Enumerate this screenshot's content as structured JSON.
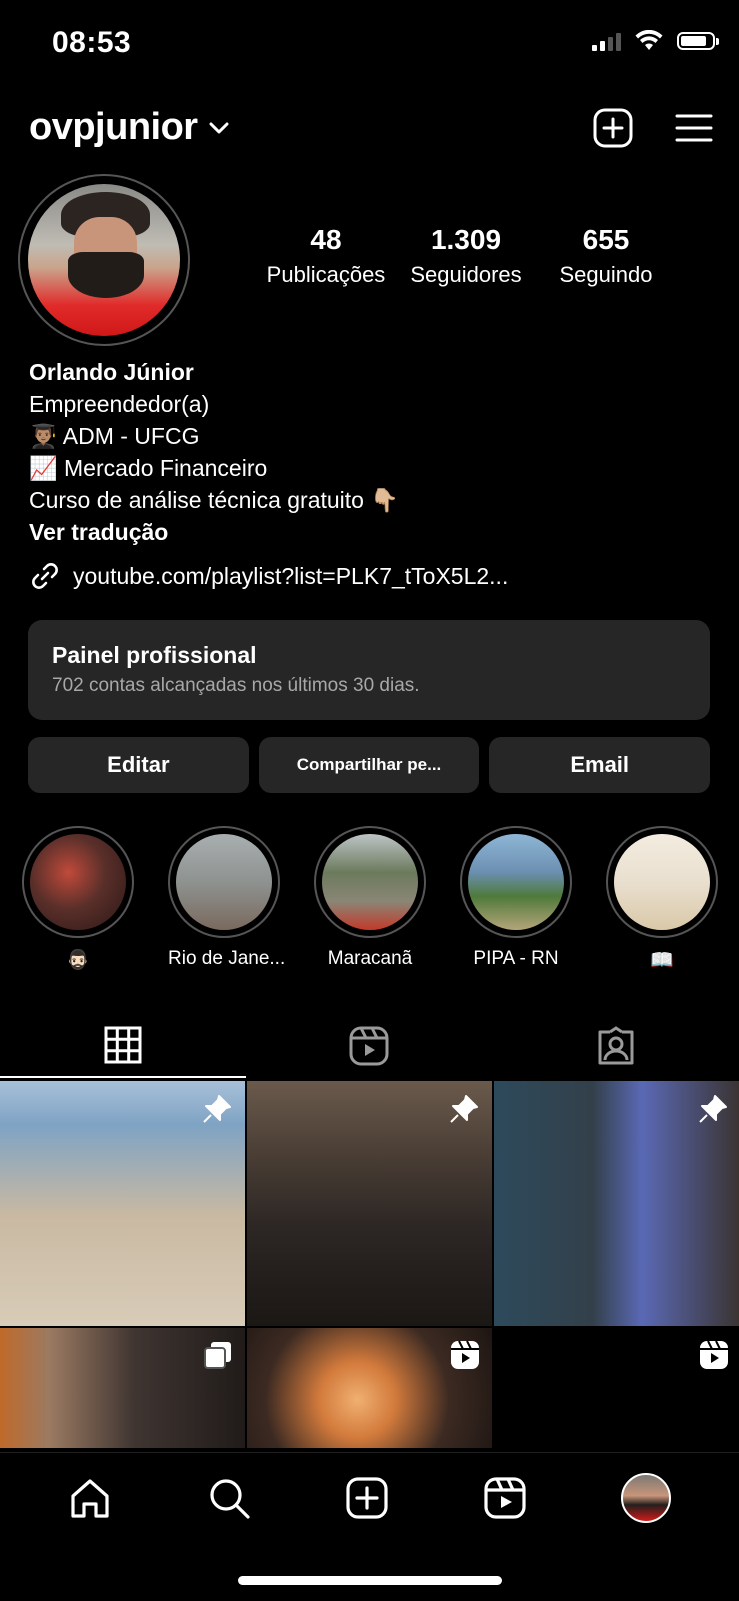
{
  "status_bar": {
    "time": "08:53"
  },
  "header": {
    "username": "ovpjunior"
  },
  "stats": [
    {
      "value": "48",
      "label": "Publicações"
    },
    {
      "value": "1.309",
      "label": "Seguidores"
    },
    {
      "value": "655",
      "label": "Seguindo"
    }
  ],
  "bio": {
    "name": "Orlando Júnior",
    "category": "Empreendedor(a)",
    "line1": "👨🏽‍🎓 ADM - UFCG",
    "line2": "📈 Mercado Financeiro",
    "line3": "Curso de análise técnica gratuito 👇🏼",
    "translate": "Ver tradução",
    "link": "youtube.com/playlist?list=PLK7_tToX5L2..."
  },
  "panel": {
    "title": "Painel profissional",
    "subtitle": "702 contas alcançadas nos últimos 30 dias."
  },
  "buttons": {
    "edit": "Editar",
    "share": "Compartilhar pe...",
    "email": "Email"
  },
  "highlights": [
    {
      "label": "🧔🏻‍♂️",
      "color": "#5a2f2a"
    },
    {
      "label": "Rio de Jane...",
      "color": "#8e9290"
    },
    {
      "label": "Maracanã",
      "color": "#8a8676"
    },
    {
      "label": "PIPA - RN",
      "color": "#6b8fb0"
    },
    {
      "label": "📖",
      "color": "#e9dfcf"
    }
  ],
  "tabs": [
    "grid-icon",
    "reels-icon",
    "tagged-icon"
  ],
  "posts": [
    {
      "type": "pinned",
      "colors": [
        "#7fa3c4",
        "#c9b9a2",
        "#d8ccb8"
      ]
    },
    {
      "type": "pinned",
      "colors": [
        "#6a5a4c",
        "#2c2624",
        "#1b1715"
      ]
    },
    {
      "type": "pinned",
      "colors": [
        "#33404a",
        "#5a69b5",
        "#3a3330"
      ]
    },
    {
      "type": "carousel",
      "colors": [
        "#9b7a62",
        "#3f3531",
        "#201b19"
      ]
    },
    {
      "type": "reel",
      "colors": [
        "#3c2a22",
        "#d27a3c",
        "#1d1512"
      ]
    },
    {
      "type": "reel",
      "colors": [
        "#000000",
        "#000000",
        "#000000"
      ]
    }
  ]
}
